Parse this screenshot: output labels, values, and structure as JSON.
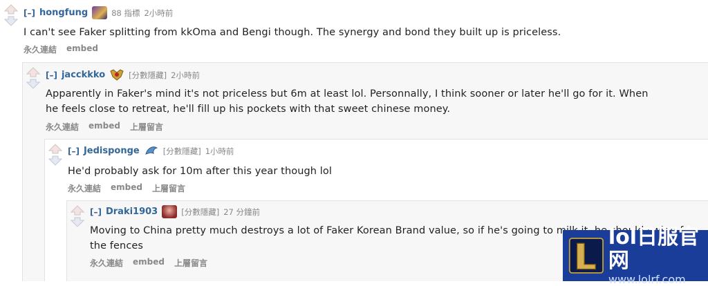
{
  "comments": [
    {
      "expand": "[–]",
      "author": "hongfung",
      "score": "88 指標",
      "time": "2小時前",
      "body": "I can't see Faker splitting from kkOma and Bengi though. The synergy and bond they built up is priceless.",
      "buttons": [
        "永久連結",
        "embed"
      ]
    },
    {
      "expand": "[–]",
      "author": "jacckkko",
      "score": "[分數隱藏]",
      "time": "2小時前",
      "body_lines": [
        "Apparently in Faker's mind it's not priceless but 6m at least lol. Personnally, I think sooner or later he'll go for it. When",
        "he feels close to retreat, he'll fill up his pockets with that sweet chinese money."
      ],
      "buttons": [
        "永久連結",
        "embed",
        "上層留言"
      ]
    },
    {
      "expand": "[–]",
      "author": "Jedisponge",
      "score": "[分數隱藏]",
      "time": "1小時前",
      "body": "He'd probably ask for 10m after this year though lol",
      "buttons": [
        "永久連結",
        "embed",
        "上層留言"
      ]
    },
    {
      "expand": "[–]",
      "author": "Draki1903",
      "score": "[分數隱藏]",
      "time": "27 分鐘前",
      "body_lines": [
        "Moving to China pretty much destroys a lot of Faker Korean Brand value, so if he's going to milk it, he should swing for",
        "the fences"
      ],
      "buttons": [
        "永久連結",
        "embed",
        "上層留言"
      ]
    }
  ],
  "watermark": {
    "title": "lol日服官网",
    "url": "www.lolrf.com"
  },
  "colors": {
    "link": "#336699",
    "muted": "#888888",
    "nested_bg": "#f7f7f8",
    "border": "#e1e1e6",
    "watermark_bg": "#1b3d9a"
  }
}
